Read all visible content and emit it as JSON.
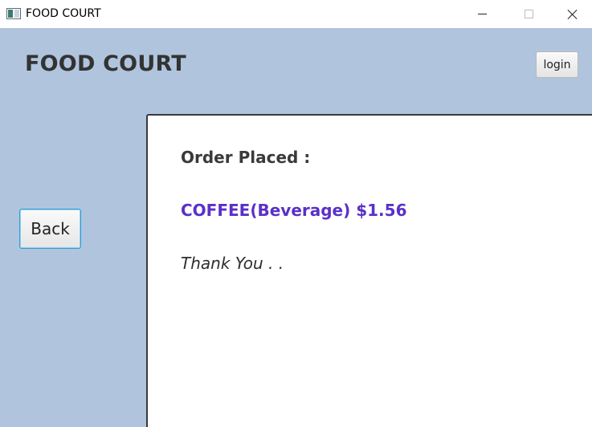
{
  "window": {
    "title": "FOOD COURT",
    "icons": [
      "app-icon",
      "minimize-icon",
      "maximize-icon",
      "close-icon"
    ]
  },
  "header": {
    "title": "FOOD COURT",
    "login_label": "login"
  },
  "nav": {
    "back_label": "Back"
  },
  "order": {
    "heading": "Order Placed :",
    "item": "COFFEE(Beverage) $1.56",
    "thanks": "Thank You . ."
  },
  "colors": {
    "background": "#b0c4de",
    "item_text": "#5a30c8",
    "focus_border": "#2a9fd8"
  }
}
